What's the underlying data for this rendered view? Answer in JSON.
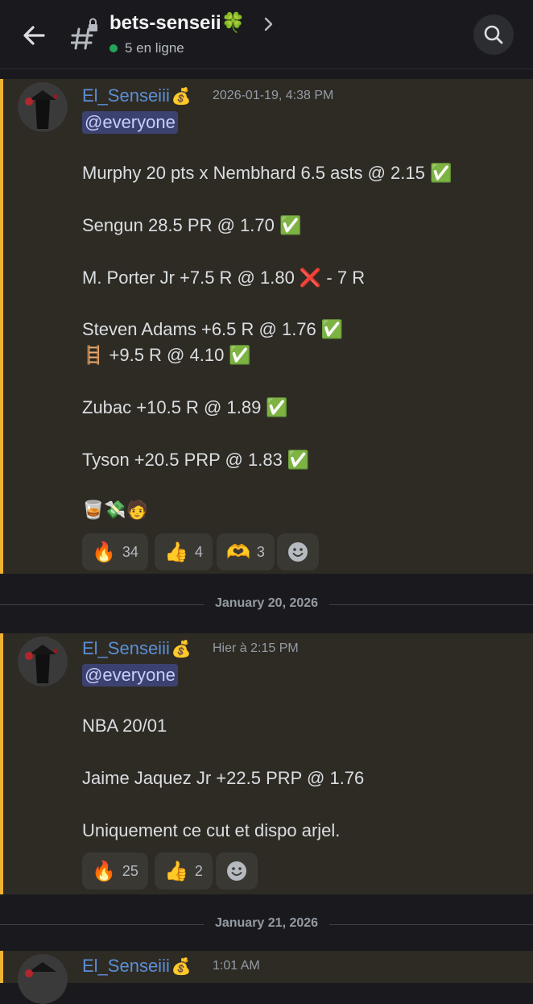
{
  "header": {
    "channel_name": "bets-senseii🍀",
    "online_text": "5 en ligne"
  },
  "messages": [
    {
      "author": "El_Senseiii",
      "author_badge": "💰",
      "timestamp": "2026-01-19, 4:38 PM",
      "mention": "@everyone",
      "lines": [
        "Murphy 20 pts x Nembhard 6.5 asts @ 2.15 ✅",
        "Sengun 28.5 PR @ 1.70 ✅",
        "M. Porter Jr +7.5 R @ 1.80 ❌ - 7 R",
        "Steven Adams +6.5 R @ 1.76 ✅",
        "🪜 +9.5 R @ 4.10 ✅",
        "Zubac +10.5 R @ 1.89 ✅",
        "Tyson +20.5 PRP @ 1.83 ✅",
        "🥃💸🧑"
      ],
      "reactions": [
        {
          "emoji": "🔥",
          "count": "34"
        },
        {
          "emoji": "👍",
          "count": "4"
        },
        {
          "emoji": "🫶",
          "count": "3"
        }
      ]
    },
    {
      "author": "El_Senseiii",
      "author_badge": "💰",
      "timestamp": "Hier à 2:15 PM",
      "mention": "@everyone",
      "lines": [
        "NBA 20/01",
        "Jaime Jaquez Jr +22.5 PRP @ 1.76",
        "Uniquement ce cut et dispo arjel."
      ],
      "reactions": [
        {
          "emoji": "🔥",
          "count": "25"
        },
        {
          "emoji": "👍",
          "count": "2"
        }
      ]
    },
    {
      "author": "El_Senseiii",
      "author_badge": "💰",
      "timestamp": "1:01 AM"
    }
  ],
  "dividers": [
    "January 20, 2026",
    "January 21, 2026"
  ],
  "colors": {
    "accent_mention_border": "#f0b232",
    "author": "#5b8fd6",
    "online": "#23a55a"
  }
}
